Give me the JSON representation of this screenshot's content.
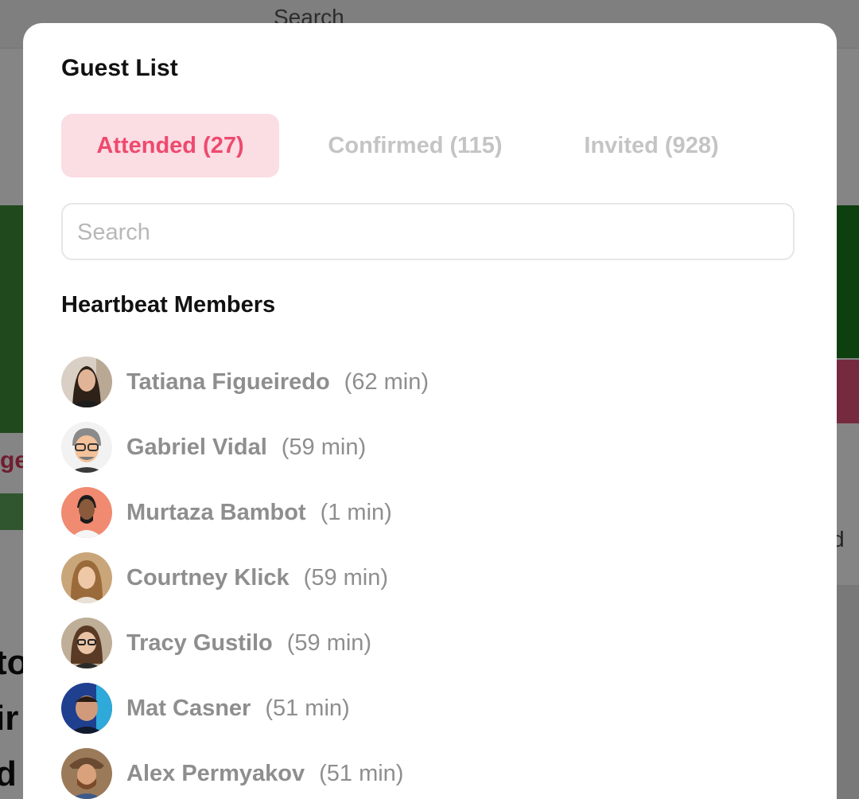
{
  "background": {
    "search_text": "Search",
    "red_text": "ge",
    "right_text": "d",
    "big_letters": [
      "to",
      "ir",
      "d"
    ]
  },
  "modal": {
    "title": "Guest List",
    "tabs": [
      {
        "label": "Attended (27)",
        "active": true
      },
      {
        "label": "Confirmed (115)",
        "active": false
      },
      {
        "label": "Invited (928)",
        "active": false
      }
    ],
    "search": {
      "placeholder": "Search",
      "value": ""
    },
    "section_heading": "Heartbeat Members",
    "members": [
      {
        "name": "Tatiana Figueiredo",
        "duration": "(62 min)"
      },
      {
        "name": "Gabriel Vidal",
        "duration": "(59 min)"
      },
      {
        "name": "Murtaza Bambot",
        "duration": "(1 min)"
      },
      {
        "name": "Courtney Klick",
        "duration": "(59 min)"
      },
      {
        "name": "Tracy Gustilo",
        "duration": "(59 min)"
      },
      {
        "name": "Mat Casner",
        "duration": "(51 min)"
      },
      {
        "name": "Alex Permyakov",
        "duration": "(51 min)"
      }
    ]
  },
  "colors": {
    "accent": "#ee4a6e",
    "accent_bg": "#fbdde4",
    "inactive_tab": "#c4c4c4",
    "member_text": "#8e8e8e"
  }
}
